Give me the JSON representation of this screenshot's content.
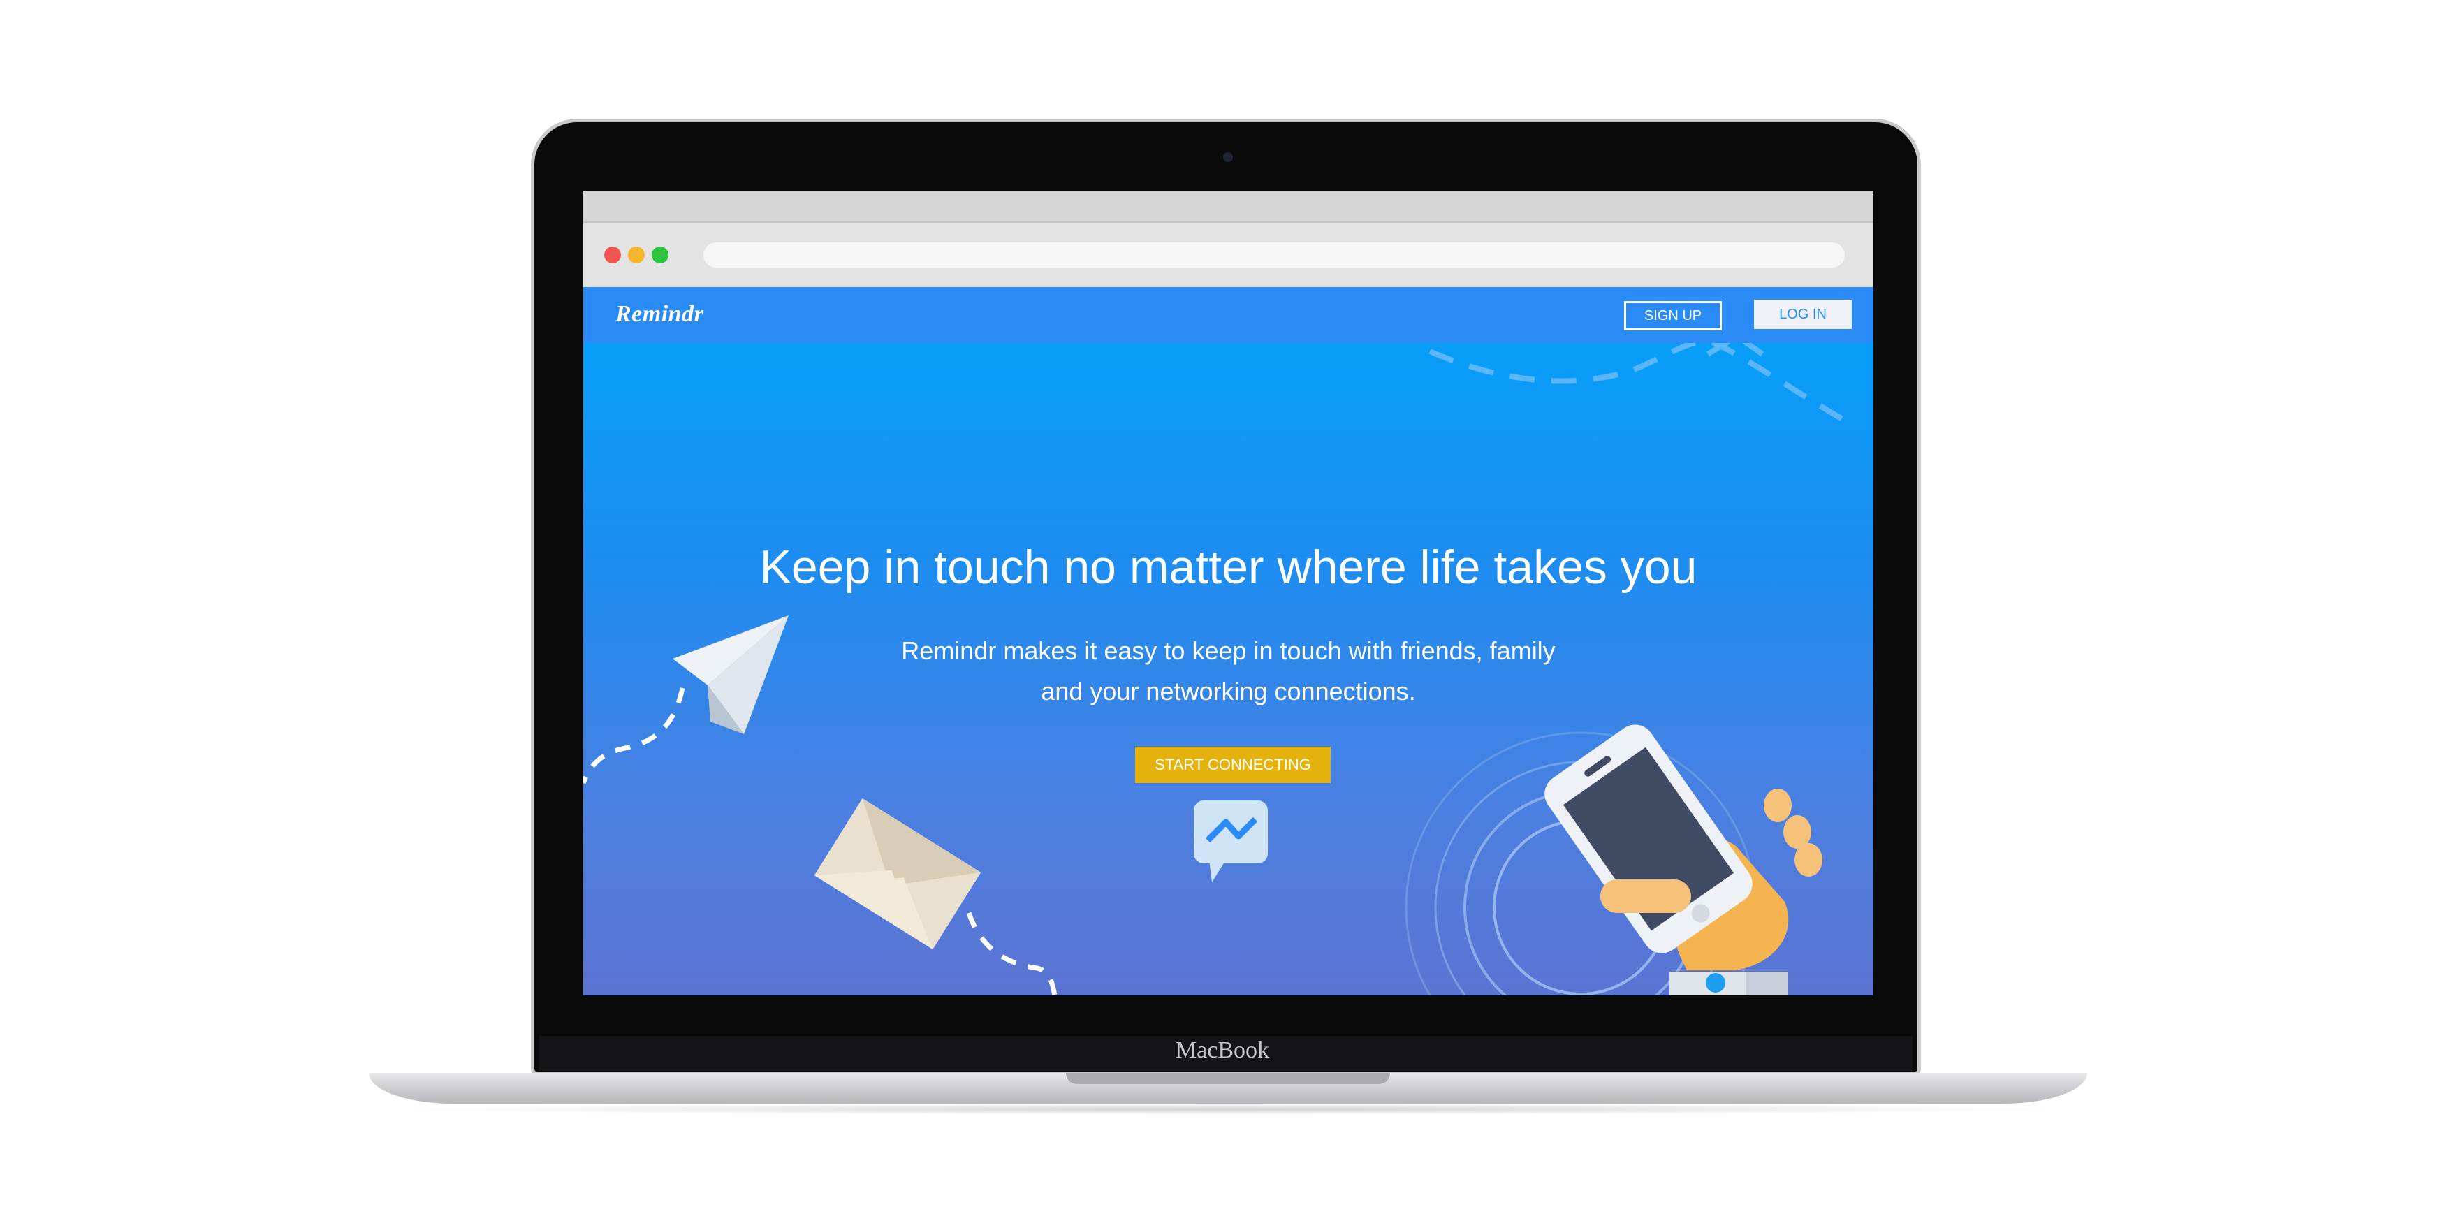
{
  "device": {
    "brand": "MacBook"
  },
  "browser": {
    "window_controls": [
      "close",
      "minimize",
      "zoom"
    ]
  },
  "site": {
    "logo": "Remindr",
    "nav": {
      "signup_label": "SIGN UP",
      "login_label": "LOG IN"
    },
    "hero": {
      "headline": "Keep in touch no matter where life takes you",
      "subtitle_line1": "Remindr makes it easy to keep in touch with friends, family",
      "subtitle_line2": "and your networking connections.",
      "cta_label": "START CONNECTING"
    },
    "illustrations": [
      "paper-plane-icon",
      "envelope-icon",
      "messenger-icon",
      "phone-in-hand-icon"
    ]
  },
  "colors": {
    "accent": "#2a8af6",
    "cta": "#e3b20c",
    "gradient_top": "#01a3fb",
    "gradient_bottom": "#5b74d2"
  }
}
